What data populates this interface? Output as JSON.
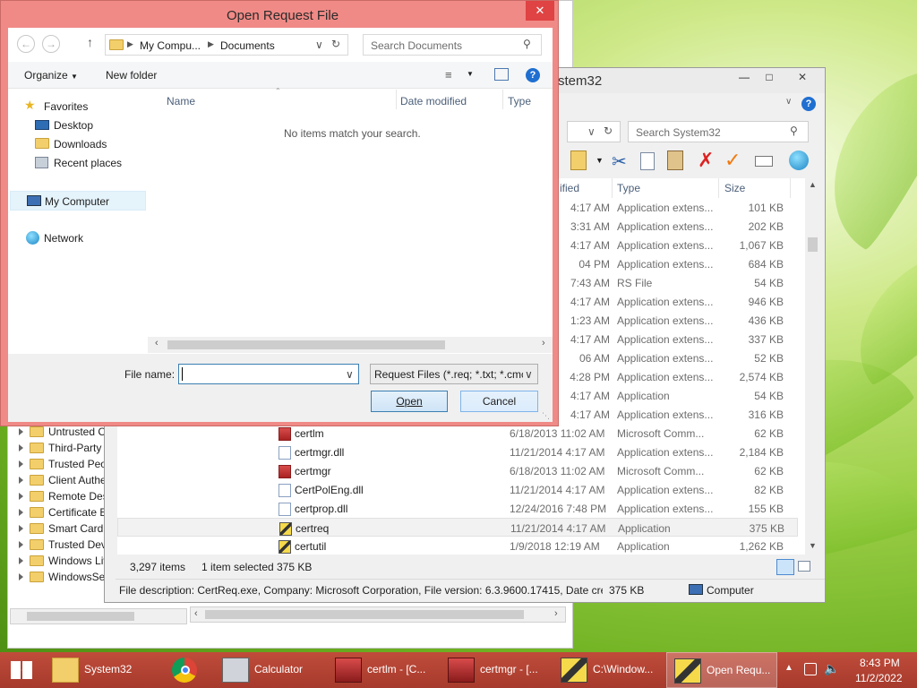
{
  "dialog": {
    "title": "Open Request File",
    "breadcrumb": [
      "My Compu...",
      "Documents"
    ],
    "search_placeholder": "Search Documents",
    "toolbar": {
      "organize": "Organize",
      "new_folder": "New folder"
    },
    "nav": {
      "favorites": "Favorites",
      "desktop": "Desktop",
      "downloads": "Downloads",
      "recent": "Recent places",
      "computer": "My Computer",
      "network": "Network"
    },
    "columns": {
      "name": "Name",
      "date": "Date modified",
      "type": "Type"
    },
    "empty_message": "No items match your search.",
    "file_name_label": "File name:",
    "file_name_value": "",
    "filter": "Request Files (*.req; *.txt; *.cmc",
    "open": "Open",
    "cancel": "Cancel"
  },
  "explorer": {
    "title": "stem32",
    "search_placeholder": "Search System32",
    "columns": {
      "date": "ified",
      "type": "Type",
      "size": "Size"
    },
    "rows": [
      {
        "date": "4:17 AM",
        "type": "Application extens...",
        "size": "101 KB"
      },
      {
        "date": "3:31 AM",
        "type": "Application extens...",
        "size": "202 KB"
      },
      {
        "date": "4:17 AM",
        "type": "Application extens...",
        "size": "1,067 KB"
      },
      {
        "date": "04 PM",
        "type": "Application extens...",
        "size": "684 KB"
      },
      {
        "date": "7:43 AM",
        "type": "RS File",
        "size": "54 KB"
      },
      {
        "date": "4:17 AM",
        "type": "Application extens...",
        "size": "946 KB"
      },
      {
        "date": "1:23 AM",
        "type": "Application extens...",
        "size": "436 KB"
      },
      {
        "date": "4:17 AM",
        "type": "Application extens...",
        "size": "337 KB"
      },
      {
        "date": "06 AM",
        "type": "Application extens...",
        "size": "52 KB"
      },
      {
        "date": "4:28 PM",
        "type": "Application extens...",
        "size": "2,574 KB"
      },
      {
        "date": "4:17 AM",
        "type": "Application",
        "size": "54 KB"
      },
      {
        "date": "4:17 AM",
        "type": "Application extens...",
        "size": "316 KB"
      }
    ],
    "full_rows": [
      {
        "name": "certlm",
        "date": "6/18/2013 11:02 AM",
        "type": "Microsoft Comm...",
        "size": "62 KB",
        "icon": "tool"
      },
      {
        "name": "certmgr.dll",
        "date": "11/21/2014 4:17 AM",
        "type": "Application extens...",
        "size": "2,184 KB",
        "icon": "dll"
      },
      {
        "name": "certmgr",
        "date": "6/18/2013 11:02 AM",
        "type": "Microsoft Comm...",
        "size": "62 KB",
        "icon": "tool"
      },
      {
        "name": "CertPolEng.dll",
        "date": "11/21/2014 4:17 AM",
        "type": "Application extens...",
        "size": "82 KB",
        "icon": "dll"
      },
      {
        "name": "certprop.dll",
        "date": "12/24/2016 7:48 PM",
        "type": "Application extens...",
        "size": "155 KB",
        "icon": "dll"
      },
      {
        "name": "certreq",
        "date": "11/21/2014 4:17 AM",
        "type": "Application",
        "size": "375 KB",
        "icon": "app"
      },
      {
        "name": "certutil",
        "date": "1/9/2018 12:19 AM",
        "type": "Application",
        "size": "1,262 KB",
        "icon": "app"
      }
    ],
    "tree": [
      "Untrusted Ce",
      "Third-Party R",
      "Trusted Peop",
      "Client Authen",
      "Remote Desk",
      "Certificate En",
      "Smart Card T",
      "Trusted Devic",
      "Windows Live",
      "WindowsServ"
    ],
    "status": {
      "count": "3,297 items",
      "selected": "1 item selected",
      "size": "375 KB"
    },
    "details": {
      "description": "File description: CertReq.exe, Company: Microsoft Corporation, File version: 6.3.9600.17415, Date create",
      "size": "375 KB",
      "location": "Computer"
    }
  },
  "taskbar": {
    "items": [
      "System32",
      "",
      "Calculator",
      "certlm - [C...",
      "certmgr - [...",
      "C:\\Window...",
      "Open Requ..."
    ],
    "time": "8:43 PM",
    "date": "11/2/2022"
  }
}
